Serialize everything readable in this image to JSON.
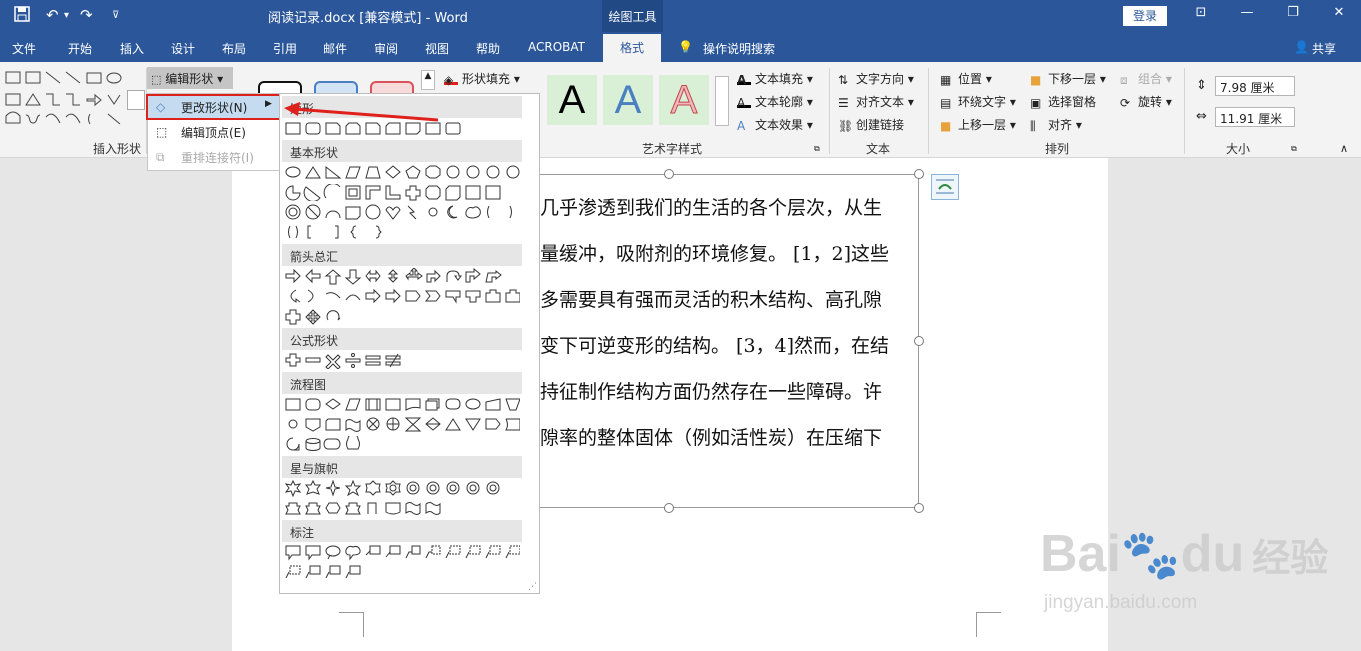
{
  "titlebar": {
    "doc_title": "阅读记录.docx [兼容模式] - Word",
    "context_tools": "绘图工具",
    "login": "登录"
  },
  "tabs": [
    "文件",
    "开始",
    "插入",
    "设计",
    "布局",
    "引用",
    "邮件",
    "审阅",
    "视图",
    "帮助",
    "ACROBAT"
  ],
  "active_tab": "格式",
  "tell_me": "操作说明搜索",
  "share": "共享",
  "ribbon": {
    "insert_shapes_label": "插入形状",
    "edit_shape_btn": "编辑形状",
    "shape_fill": "形状填充",
    "wordart_label": "艺术字样式",
    "text_fill": "文本填充",
    "text_outline": "文本轮廓",
    "text_effect": "文本效果",
    "text_direction": "文字方向",
    "align_text": "对齐文本",
    "create_link": "创建链接",
    "text_label": "文本",
    "position": "位置",
    "wrap_text": "环绕文字",
    "bring_forward": "上移一层",
    "send_backward": "下移一层",
    "selection_pane": "选择窗格",
    "align": "对齐",
    "group": "组合",
    "rotate": "旋转",
    "arrange_label": "排列",
    "height": "7.98 厘米",
    "width": "11.91 厘米",
    "size_label": "大小"
  },
  "edit_menu": {
    "change_shape": "更改形状(N)",
    "edit_points": "编辑顶点(E)",
    "reroute": "重排连接符(I)"
  },
  "shape_panel": {
    "sections": [
      "矩形",
      "基本形状",
      "箭头总汇",
      "公式形状",
      "流程图",
      "星与旗帜",
      "标注"
    ]
  },
  "document": {
    "lines": [
      "几乎渗透到我们的生活的各个层次，从生",
      "量缓冲，吸附剂的环境修复。 [1，2]这些",
      "多需要具有强而灵活的积木结构、高孔隙",
      "变下可逆变形的结构。 [3，4]然而，在结",
      "持征制作结构方面仍然存在一些障碍。许",
      "隙率的整体固体（例如活性炭）在压缩下"
    ]
  },
  "watermark": {
    "brand": "Bai",
    "brand2": "du",
    "brand3": "经验",
    "url": "jingyan.baidu.com"
  },
  "colors": {
    "word_blue": "#2b579a",
    "highlight_red": "#e0201b",
    "menu_hover": "#c5dcf0"
  }
}
